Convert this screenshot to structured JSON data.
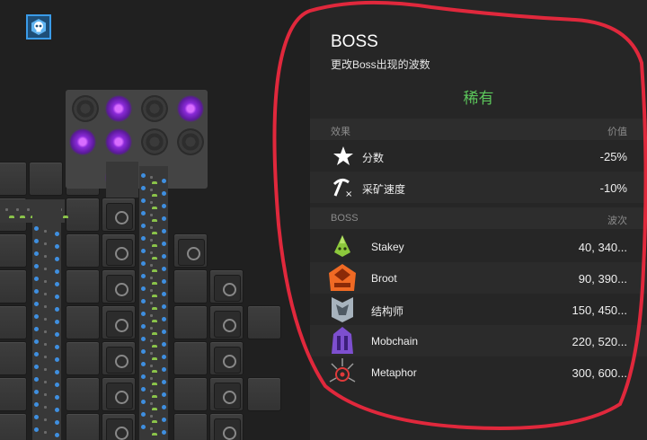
{
  "panel": {
    "title": "BOSS",
    "description": "更改Boss出现的波数",
    "rarity": "稀有",
    "rarity_color": "#5cc65b",
    "effects_header": {
      "label": "效果",
      "value_label": "价值"
    },
    "effects": [
      {
        "icon": "star-icon",
        "label": "分数",
        "value": "-25%"
      },
      {
        "icon": "pickaxe-icon",
        "label": "采矿速度",
        "value": "-10%"
      }
    ],
    "bosses_header": {
      "label": "BOSS",
      "value_label": "波次"
    },
    "bosses": [
      {
        "icon": "stakey-icon",
        "name": "Stakey",
        "waves": "40, 340..."
      },
      {
        "icon": "broot-icon",
        "name": "Broot",
        "waves": "90, 390..."
      },
      {
        "icon": "constructor-icon",
        "name": "结构师",
        "waves": "150, 450..."
      },
      {
        "icon": "mobchain-icon",
        "name": "Mobchain",
        "waves": "220, 520..."
      },
      {
        "icon": "metaphor-icon",
        "name": "Metaphor",
        "waves": "300, 600..."
      }
    ]
  },
  "menu_button": {
    "icon": "skull-menu-icon"
  },
  "colors": {
    "annotation": "#e0283c",
    "accent": "#3a9be8",
    "portal": "#9b3ae8"
  }
}
